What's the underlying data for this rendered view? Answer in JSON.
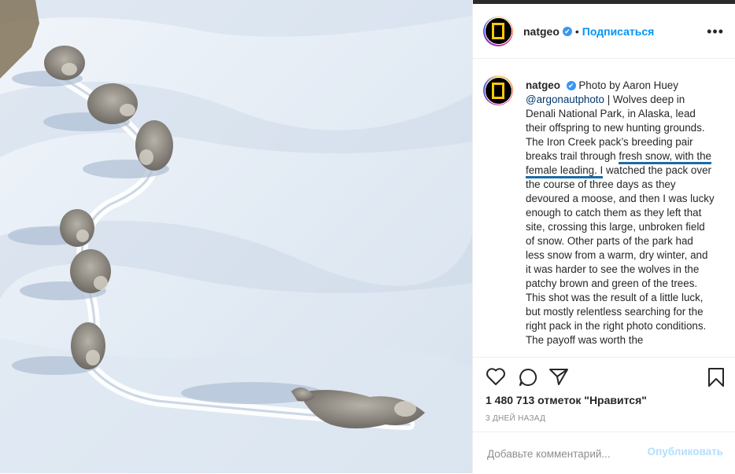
{
  "account": {
    "username": "natgeo",
    "verified_mark": "✔",
    "separator": "•",
    "follow_label": "Подписаться",
    "more_icon": "more-horizontal-icon"
  },
  "caption": {
    "username": "natgeo",
    "text_before_mention": "Photo by Aaron Huey",
    "mention": "@argonautphoto",
    "text_after_mention": "| Wolves deep in Denali National Park, in Alaska, lead their offspring to new hunting grounds. The Iron Creek pack’s breeding pair breaks trail through",
    "highlighted": "fresh snow, with the female leading. I",
    "text_rest": "watched the pack over the course of three days as they devoured a moose, and then I was lucky enough to catch them as they left that site, crossing this large, unbroken field of snow. Other parts of the park had less snow from a warm, dry winter, and it was harder to see the wolves in the patchy brown and green of the trees. This shot was the result of a little luck, but mostly relentless searching for the right pack in the right photo conditions. The payoff was worth the"
  },
  "actions": {
    "likes": "1 480 713 отметок \"Нравится\"",
    "time_ago": "3 ДНЕЙ НАЗАД"
  },
  "comment": {
    "placeholder": "Добавьте комментарий...",
    "post_label": "Опубликовать"
  },
  "colors": {
    "link_blue": "#0095f6",
    "mention_blue": "#00376b",
    "highlight_underline": "#1a6ba8",
    "post_disabled": "#b2dffc"
  }
}
